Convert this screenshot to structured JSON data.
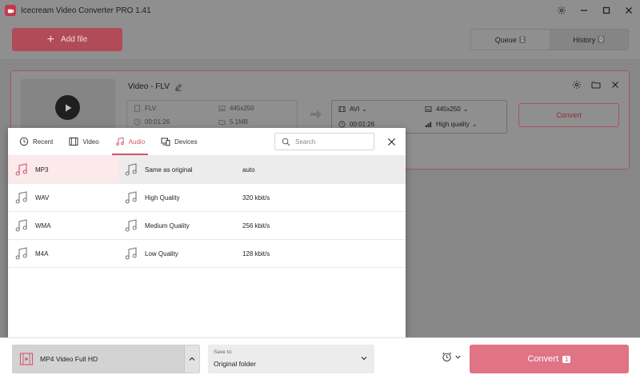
{
  "window": {
    "title": "Icecream Video Converter PRO 1.41"
  },
  "toolbar": {
    "add_file_label": "Add file",
    "queue_label": "Queue",
    "queue_count": "1",
    "history_label": "History",
    "history_count": "0"
  },
  "file_card": {
    "name": "Video - FLV",
    "source": {
      "format": "FLV",
      "resolution": "445x250",
      "duration": "00:01:26",
      "size": "5.1MB"
    },
    "target": {
      "format": "AVI",
      "resolution": "445x250",
      "duration": "00:01:26",
      "quality": "High quality"
    },
    "convert_label": "Convert"
  },
  "format_panel": {
    "tabs": [
      {
        "label": "Recent",
        "icon": "clock-icon"
      },
      {
        "label": "Video",
        "icon": "film-icon"
      },
      {
        "label": "Audio",
        "icon": "music-icon",
        "active": true
      },
      {
        "label": "Devices",
        "icon": "devices-icon"
      }
    ],
    "search_placeholder": "Search",
    "rows": [
      {
        "format": "MP3",
        "quality": "Same as original",
        "bitrate": "auto",
        "selected": true
      },
      {
        "format": "WAV",
        "quality": "High Quality",
        "bitrate": "320 kbit/s"
      },
      {
        "format": "WMA",
        "quality": "Medium Quality",
        "bitrate": "256 kbit/s"
      },
      {
        "format": "M4A",
        "quality": "Low Quality",
        "bitrate": "128 kbit/s"
      }
    ]
  },
  "bottom": {
    "profile_label": "MP4 Video Full HD",
    "save_to_label": "Save to:",
    "save_to_value": "Original folder",
    "convert_label": "Convert",
    "convert_count": "1"
  },
  "colors": {
    "accent": "#d1566a",
    "convert_button": "#e07384"
  }
}
